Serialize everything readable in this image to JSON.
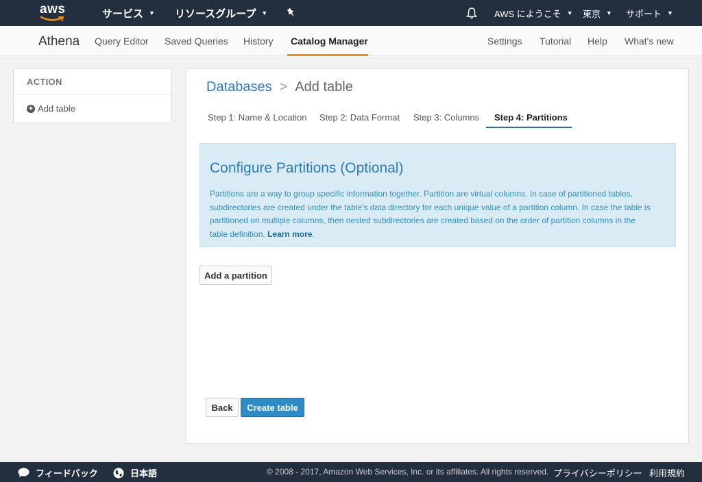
{
  "topbar": {
    "logo_text": "aws",
    "services_label": "サービス",
    "resource_groups_label": "リソースグループ",
    "account_label": "AWS にようこそ",
    "region_label": "東京",
    "support_label": "サポート"
  },
  "subnav": {
    "brand": "Athena",
    "items": [
      "Query Editor",
      "Saved Queries",
      "History",
      "Catalog Manager"
    ],
    "right_items": [
      "Settings",
      "Tutorial",
      "Help",
      "What's new"
    ],
    "active_item": "Catalog Manager"
  },
  "sidebar": {
    "heading": "ACTION",
    "add_table_label": "Add table"
  },
  "breadcrumb": {
    "link": "Databases",
    "separator": ">",
    "current": "Add table"
  },
  "steps": [
    "Step 1: Name & Location",
    "Step 2: Data Format",
    "Step 3: Columns",
    "Step 4: Partitions"
  ],
  "active_step": "Step 4: Partitions",
  "info": {
    "title": "Configure Partitions (Optional)",
    "body": "Partitions are a way to group specific information together. Partition are virtual columns. In case of partitioned tables, subdirectories are created under the table's data directory for each unique value of a partition column. In case the table is partitioned on multiple columns, then nested subdirectories are created based on the order of partition columns in the table definition.",
    "learn_more": "Learn more",
    "trailing": "."
  },
  "buttons": {
    "add_partition": "Add a partition",
    "back": "Back",
    "create_table": "Create table"
  },
  "footer": {
    "feedback": "フィードバック",
    "language": "日本語",
    "copyright": "© 2008 - 2017, Amazon Web Services, Inc. or its affiliates. All rights reserved.",
    "privacy": "プライバシーポリシー",
    "terms": "利用規約"
  },
  "colors": {
    "topbar_bg": "#232f3e",
    "accent_orange": "#f28e1a",
    "link_blue": "#2b7bb9",
    "info_bg": "#d9ecf5",
    "primary_button": "#2f8bc4"
  }
}
